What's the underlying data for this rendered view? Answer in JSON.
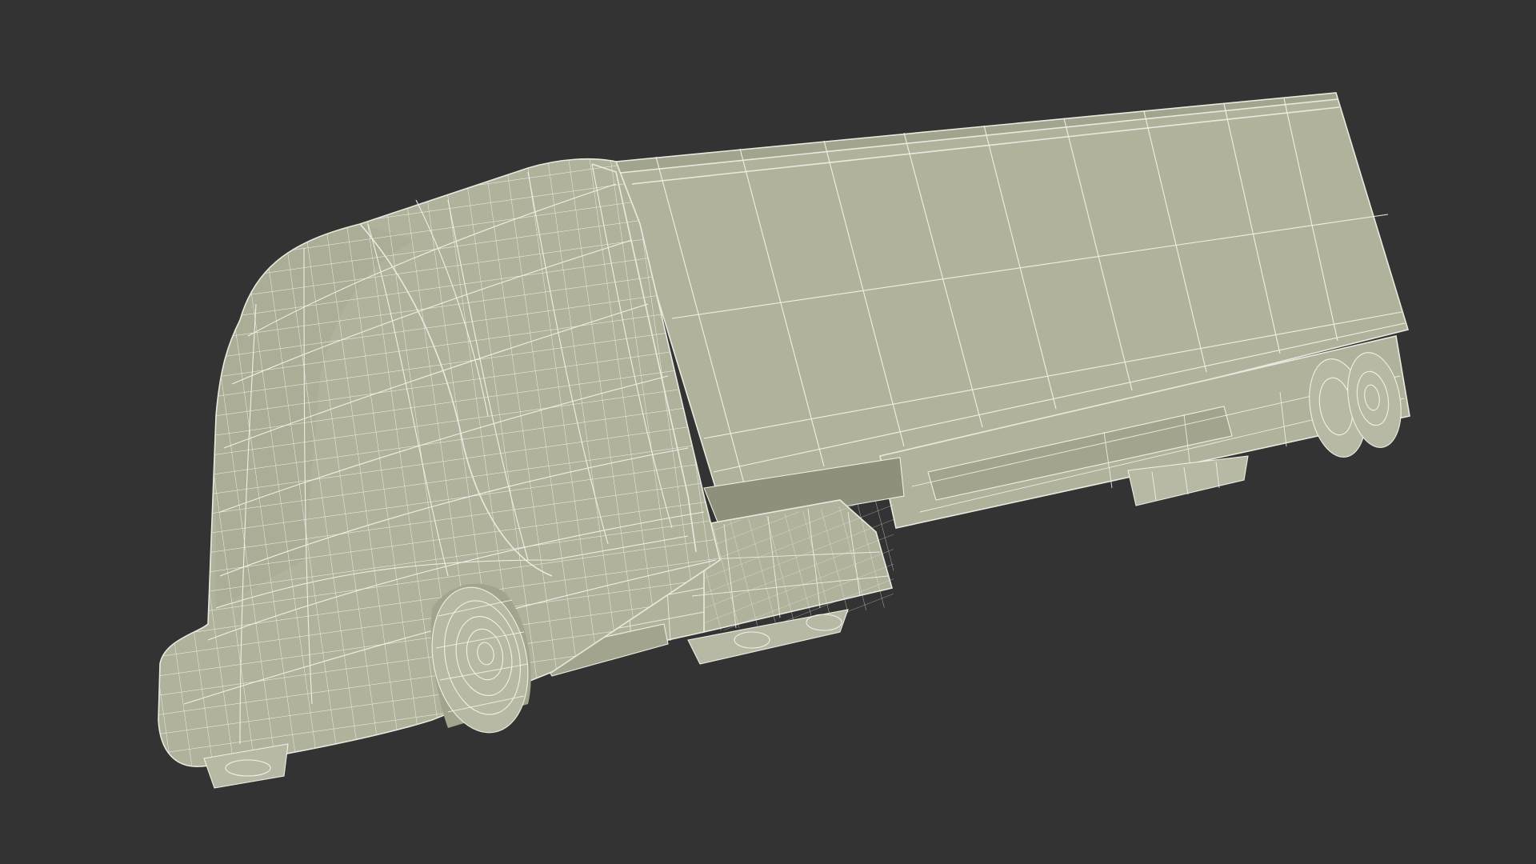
{
  "scene": {
    "subject": "semi-truck-wireframe-render",
    "background_color": "#333333",
    "model_color": "#b1b29c",
    "wire_color": "#f2f3ea"
  }
}
